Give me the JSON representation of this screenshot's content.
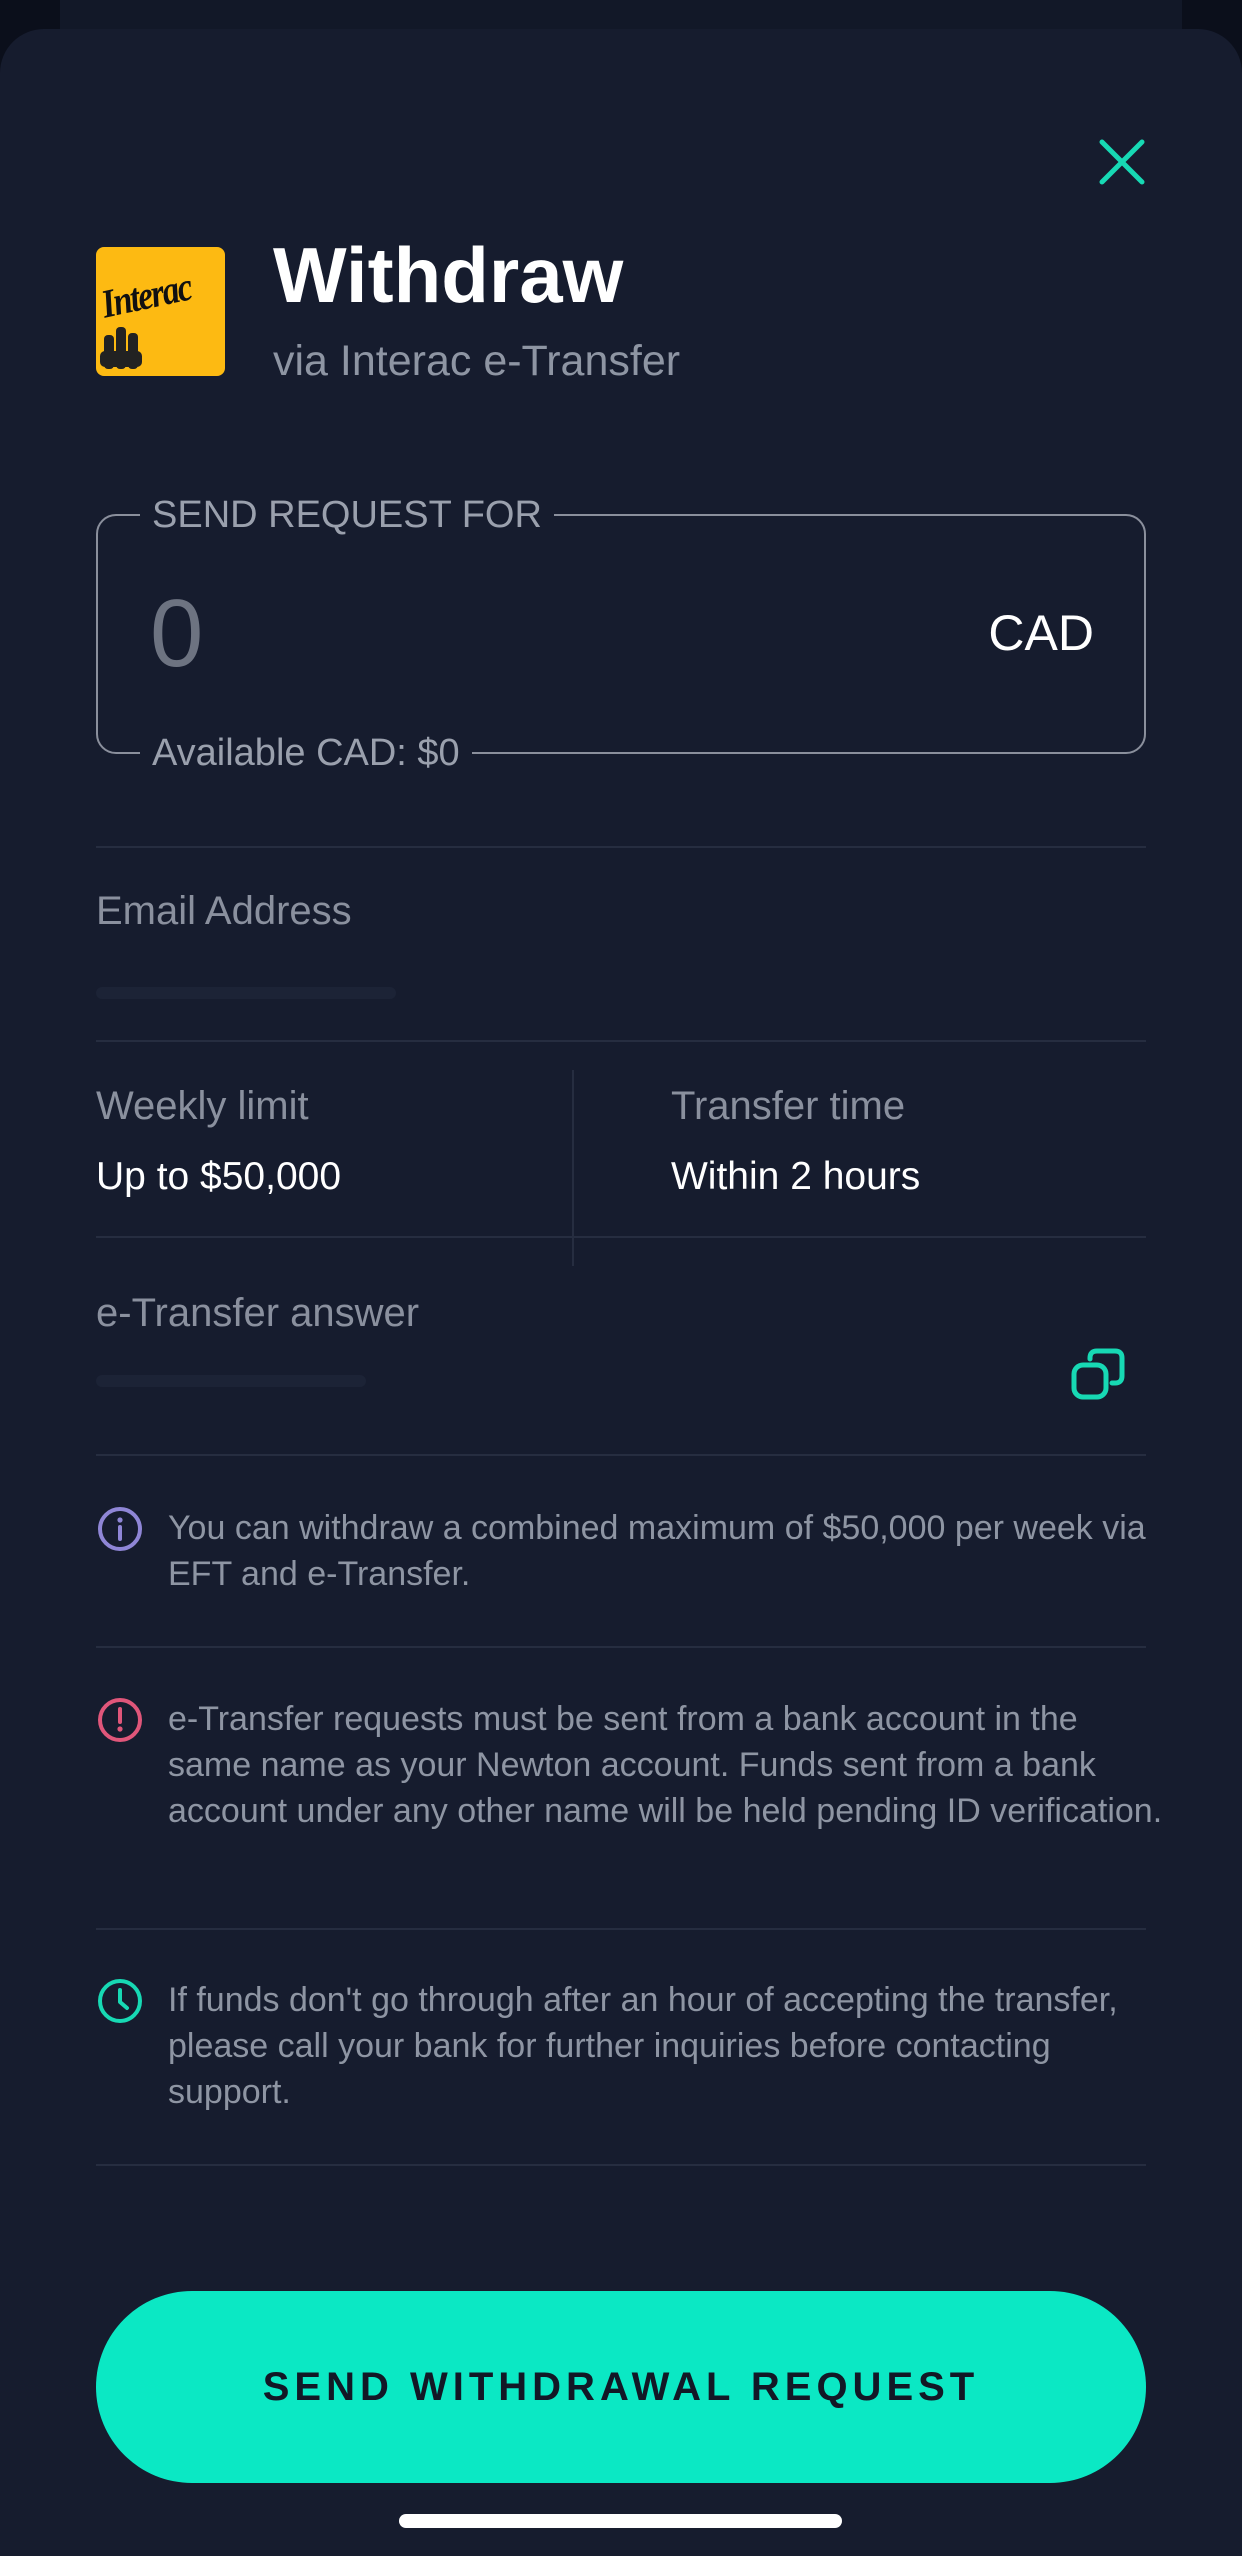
{
  "header": {
    "title": "Withdraw",
    "subtitle": "via Interac e-Transfer",
    "logo_text": "Interac"
  },
  "amount": {
    "legend": "SEND REQUEST FOR",
    "value": "0",
    "currency": "CAD",
    "available": "Available CAD: $0"
  },
  "email": {
    "label": "Email Address"
  },
  "limits": {
    "weekly_label": "Weekly limit",
    "weekly_value": "Up to $50,000",
    "time_label": "Transfer time",
    "time_value": "Within 2 hours"
  },
  "answer": {
    "label": "e-Transfer answer"
  },
  "notices": [
    {
      "icon": "info-icon",
      "color": "#8f86d6",
      "text": "You can withdraw a combined maximum of $50,000 per week via EFT and e-Transfer."
    },
    {
      "icon": "alert-icon",
      "color": "#e0567a",
      "text": "e-Transfer requests must be sent from a bank account in the same name as your Newton account. Funds sent from a bank account under any other name will be held pending ID verification."
    },
    {
      "icon": "clock-icon",
      "color": "#17d9b4",
      "text": "If funds don't go through after an hour of accepting the transfer, please call your bank for further inquiries before contacting support."
    }
  ],
  "actions": {
    "submit_label": "SEND WITHDRAWAL REQUEST"
  },
  "colors": {
    "accent": "#0be8c4",
    "background": "#161c2e",
    "logo_yellow": "#fdba12"
  }
}
